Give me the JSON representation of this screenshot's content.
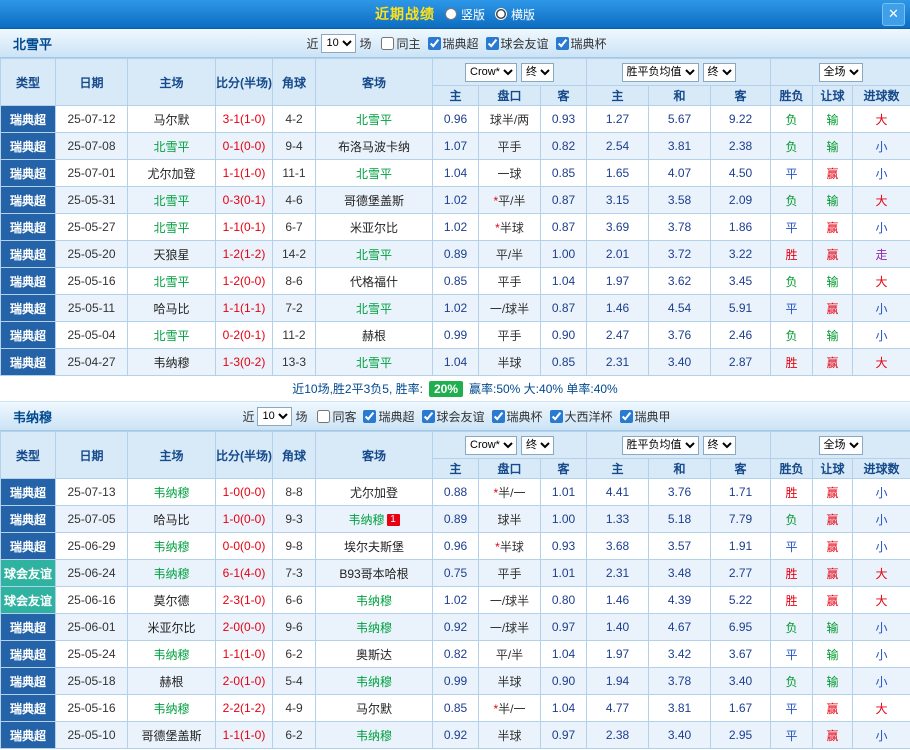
{
  "topbar": {
    "title": "近期战绩",
    "radio_vertical": "竖版",
    "radio_horizontal": "横版",
    "close": "✕"
  },
  "table": {
    "near": {
      "prefix": "近",
      "value": "10",
      "suffix": "场"
    },
    "static_cols": [
      "类型",
      "日期",
      "主场",
      "比分(半场)",
      "角球",
      "客场"
    ],
    "dropdowns": {
      "company": "Crow*",
      "final1": "终",
      "avg": "胜平负均值",
      "final2": "终",
      "scope": "全场"
    },
    "sub_cols": [
      "主",
      "盘口",
      "客",
      "主",
      "和",
      "客",
      "胜负",
      "让球",
      "进球数"
    ]
  },
  "colors": {
    "league": {
      "瑞典超": "#2563a8",
      "球会友谊": "#2fb3a0"
    },
    "result": {
      "胜": "#e60012",
      "负": "#00992e",
      "平": "#2653c6",
      "赢": "#e60012",
      "输": "#00992e",
      "大": "#e60012",
      "小": "#2653c6",
      "走": "#9326b5"
    },
    "focus_team": "#00a040",
    "score": "#e60012",
    "odds": "#1d3e8f",
    "badge_bg": "#1faf4e"
  },
  "sections": [
    {
      "team": "北雪平",
      "filters": [
        {
          "label": "同主",
          "checked": false
        },
        {
          "label": "瑞典超",
          "checked": true
        },
        {
          "label": "球会友谊",
          "checked": true
        },
        {
          "label": "瑞典杯",
          "checked": true
        }
      ],
      "rows": [
        {
          "league": "瑞典超",
          "date": "25-07-12",
          "home": "马尔默",
          "home_focus": false,
          "score": "3-1(1-0)",
          "corners": "4-2",
          "away": "北雪平",
          "away_focus": true,
          "ah": [
            "0.96",
            "球半/两",
            "0.93"
          ],
          "eu": [
            "1.27",
            "5.67",
            "9.22"
          ],
          "res": [
            "负",
            "输",
            "大"
          ]
        },
        {
          "league": "瑞典超",
          "date": "25-07-08",
          "home": "北雪平",
          "home_focus": true,
          "score": "0-1(0-0)",
          "corners": "9-4",
          "away": "布洛马波卡纳",
          "away_focus": false,
          "ah": [
            "1.07",
            "平手",
            "0.82"
          ],
          "eu": [
            "2.54",
            "3.81",
            "2.38"
          ],
          "res": [
            "负",
            "输",
            "小"
          ]
        },
        {
          "league": "瑞典超",
          "date": "25-07-01",
          "home": "尤尔加登",
          "home_focus": false,
          "score": "1-1(1-0)",
          "corners": "11-1",
          "away": "北雪平",
          "away_focus": true,
          "ah": [
            "1.04",
            "一球",
            "0.85"
          ],
          "eu": [
            "1.65",
            "4.07",
            "4.50"
          ],
          "res": [
            "平",
            "赢",
            "小"
          ]
        },
        {
          "league": "瑞典超",
          "date": "25-05-31",
          "home": "北雪平",
          "home_focus": true,
          "score": "0-3(0-1)",
          "corners": "4-6",
          "away": "哥德堡盖斯",
          "away_focus": false,
          "ah": [
            "1.02",
            "*平/半",
            "0.87"
          ],
          "eu": [
            "3.15",
            "3.58",
            "2.09"
          ],
          "res": [
            "负",
            "输",
            "大"
          ]
        },
        {
          "league": "瑞典超",
          "date": "25-05-27",
          "home": "北雪平",
          "home_focus": true,
          "score": "1-1(0-1)",
          "corners": "6-7",
          "away": "米亚尔比",
          "away_focus": false,
          "ah": [
            "1.02",
            "*半球",
            "0.87"
          ],
          "eu": [
            "3.69",
            "3.78",
            "1.86"
          ],
          "res": [
            "平",
            "赢",
            "小"
          ]
        },
        {
          "league": "瑞典超",
          "date": "25-05-20",
          "home": "天狼星",
          "home_focus": false,
          "score": "1-2(1-2)",
          "corners": "14-2",
          "away": "北雪平",
          "away_focus": true,
          "ah": [
            "0.89",
            "平/半",
            "1.00"
          ],
          "eu": [
            "2.01",
            "3.72",
            "3.22"
          ],
          "res": [
            "胜",
            "赢",
            "走"
          ]
        },
        {
          "league": "瑞典超",
          "date": "25-05-16",
          "home": "北雪平",
          "home_focus": true,
          "score": "1-2(0-0)",
          "corners": "8-6",
          "away": "代格福什",
          "away_focus": false,
          "ah": [
            "0.85",
            "平手",
            "1.04"
          ],
          "eu": [
            "1.97",
            "3.62",
            "3.45"
          ],
          "res": [
            "负",
            "输",
            "大"
          ]
        },
        {
          "league": "瑞典超",
          "date": "25-05-11",
          "home": "哈马比",
          "home_focus": false,
          "score": "1-1(1-1)",
          "corners": "7-2",
          "away": "北雪平",
          "away_focus": true,
          "ah": [
            "1.02",
            "一/球半",
            "0.87"
          ],
          "eu": [
            "1.46",
            "4.54",
            "5.91"
          ],
          "res": [
            "平",
            "赢",
            "小"
          ]
        },
        {
          "league": "瑞典超",
          "date": "25-05-04",
          "home": "北雪平",
          "home_focus": true,
          "score": "0-2(0-1)",
          "corners": "11-2",
          "away": "赫根",
          "away_focus": false,
          "ah": [
            "0.99",
            "平手",
            "0.90"
          ],
          "eu": [
            "2.47",
            "3.76",
            "2.46"
          ],
          "res": [
            "负",
            "输",
            "小"
          ]
        },
        {
          "league": "瑞典超",
          "date": "25-04-27",
          "home": "韦纳穆",
          "home_focus": false,
          "score": "1-3(0-2)",
          "corners": "13-3",
          "away": "北雪平",
          "away_focus": true,
          "ah": [
            "1.04",
            "半球",
            "0.85"
          ],
          "eu": [
            "2.31",
            "3.40",
            "2.87"
          ],
          "res": [
            "胜",
            "赢",
            "大"
          ]
        }
      ],
      "summary": {
        "text_before": "近10场,胜2平3负5, 胜率:",
        "badge": "20%",
        "text_after": "赢率:50% 大:40% 单率:40%"
      }
    },
    {
      "team": "韦纳穆",
      "filters": [
        {
          "label": "同客",
          "checked": false
        },
        {
          "label": "瑞典超",
          "checked": true
        },
        {
          "label": "球会友谊",
          "checked": true
        },
        {
          "label": "瑞典杯",
          "checked": true
        },
        {
          "label": "大西洋杯",
          "checked": true
        },
        {
          "label": "瑞典甲",
          "checked": true
        }
      ],
      "rows": [
        {
          "league": "瑞典超",
          "date": "25-07-13",
          "home": "韦纳穆",
          "home_focus": true,
          "score": "1-0(0-0)",
          "corners": "8-8",
          "away": "尤尔加登",
          "away_focus": false,
          "ah": [
            "0.88",
            "*半/一",
            "1.01"
          ],
          "eu": [
            "4.41",
            "3.76",
            "1.71"
          ],
          "res": [
            "胜",
            "赢",
            "小"
          ]
        },
        {
          "league": "瑞典超",
          "date": "25-07-05",
          "home": "哈马比",
          "home_focus": false,
          "score": "1-0(0-0)",
          "corners": "9-3",
          "away": "韦纳穆",
          "away_focus": true,
          "away_badge": "1",
          "ah": [
            "0.89",
            "球半",
            "1.00"
          ],
          "eu": [
            "1.33",
            "5.18",
            "7.79"
          ],
          "res": [
            "负",
            "赢",
            "小"
          ]
        },
        {
          "league": "瑞典超",
          "date": "25-06-29",
          "home": "韦纳穆",
          "home_focus": true,
          "score": "0-0(0-0)",
          "corners": "9-8",
          "away": "埃尔夫斯堡",
          "away_focus": false,
          "ah": [
            "0.96",
            "*半球",
            "0.93"
          ],
          "eu": [
            "3.68",
            "3.57",
            "1.91"
          ],
          "res": [
            "平",
            "赢",
            "小"
          ]
        },
        {
          "league": "球会友谊",
          "date": "25-06-24",
          "home": "韦纳穆",
          "home_focus": true,
          "score": "6-1(4-0)",
          "corners": "7-3",
          "away": "B93哥本哈根",
          "away_focus": false,
          "ah": [
            "0.75",
            "平手",
            "1.01"
          ],
          "eu": [
            "2.31",
            "3.48",
            "2.77"
          ],
          "res": [
            "胜",
            "赢",
            "大"
          ]
        },
        {
          "league": "球会友谊",
          "date": "25-06-16",
          "home": "莫尔德",
          "home_focus": false,
          "score": "2-3(1-0)",
          "corners": "6-6",
          "away": "韦纳穆",
          "away_focus": true,
          "ah": [
            "1.02",
            "一/球半",
            "0.80"
          ],
          "eu": [
            "1.46",
            "4.39",
            "5.22"
          ],
          "res": [
            "胜",
            "赢",
            "大"
          ]
        },
        {
          "league": "瑞典超",
          "date": "25-06-01",
          "home": "米亚尔比",
          "home_focus": false,
          "score": "2-0(0-0)",
          "corners": "9-6",
          "away": "韦纳穆",
          "away_focus": true,
          "ah": [
            "0.92",
            "一/球半",
            "0.97"
          ],
          "eu": [
            "1.40",
            "4.67",
            "6.95"
          ],
          "res": [
            "负",
            "输",
            "小"
          ]
        },
        {
          "league": "瑞典超",
          "date": "25-05-24",
          "home": "韦纳穆",
          "home_focus": true,
          "score": "1-1(1-0)",
          "corners": "6-2",
          "away": "奥斯达",
          "away_focus": false,
          "ah": [
            "0.82",
            "平/半",
            "1.04"
          ],
          "eu": [
            "1.97",
            "3.42",
            "3.67"
          ],
          "res": [
            "平",
            "输",
            "小"
          ]
        },
        {
          "league": "瑞典超",
          "date": "25-05-18",
          "home": "赫根",
          "home_focus": false,
          "score": "2-0(1-0)",
          "corners": "5-4",
          "away": "韦纳穆",
          "away_focus": true,
          "ah": [
            "0.99",
            "半球",
            "0.90"
          ],
          "eu": [
            "1.94",
            "3.78",
            "3.40"
          ],
          "res": [
            "负",
            "输",
            "小"
          ]
        },
        {
          "league": "瑞典超",
          "date": "25-05-16",
          "home": "韦纳穆",
          "home_focus": true,
          "score": "2-2(1-2)",
          "corners": "4-9",
          "away": "马尔默",
          "away_focus": false,
          "ah": [
            "0.85",
            "*半/一",
            "1.04"
          ],
          "eu": [
            "4.77",
            "3.81",
            "1.67"
          ],
          "res": [
            "平",
            "赢",
            "大"
          ]
        },
        {
          "league": "瑞典超",
          "date": "25-05-10",
          "home": "哥德堡盖斯",
          "home_focus": false,
          "score": "1-1(1-0)",
          "corners": "6-2",
          "away": "韦纳穆",
          "away_focus": true,
          "ah": [
            "0.92",
            "半球",
            "0.97"
          ],
          "eu": [
            "2.38",
            "3.40",
            "2.95"
          ],
          "res": [
            "平",
            "赢",
            "小"
          ]
        }
      ]
    }
  ]
}
